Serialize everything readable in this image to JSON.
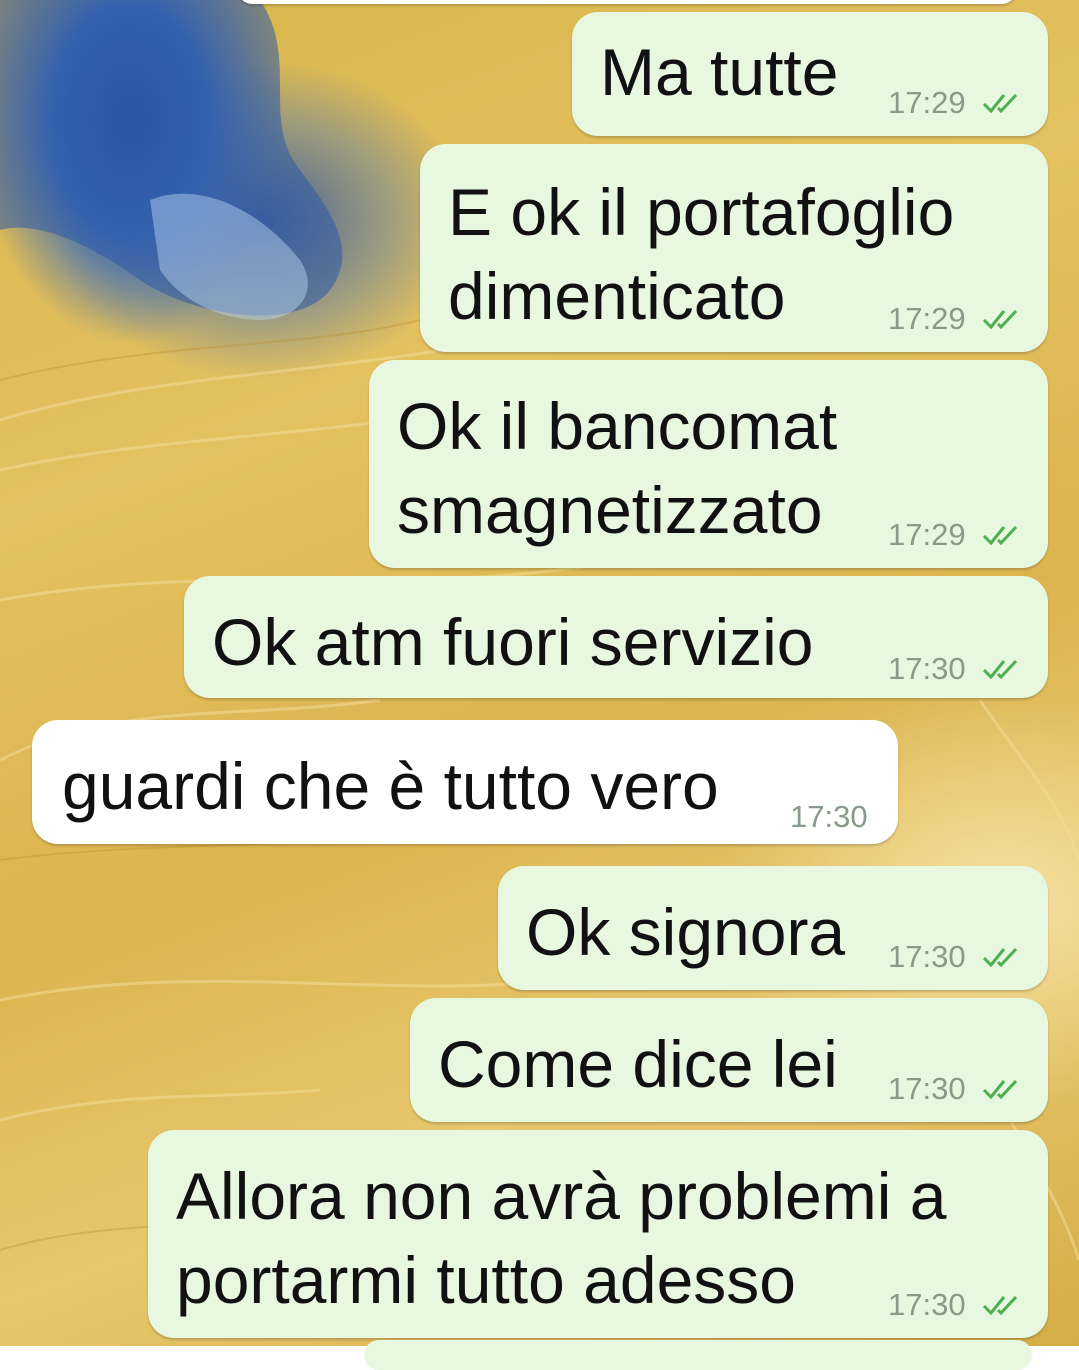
{
  "messages": [
    {
      "direction": "out",
      "text": "Ma tutte",
      "time": "17:29",
      "status_icon": "double-check-icon"
    },
    {
      "direction": "out",
      "text": "E ok il portafoglio\ndimenticato",
      "time": "17:29",
      "status_icon": "double-check-icon"
    },
    {
      "direction": "out",
      "text": "Ok il bancomat\nsmagnetizzato",
      "time": "17:29",
      "status_icon": "double-check-icon"
    },
    {
      "direction": "out",
      "text": "Ok atm fuori servizio",
      "time": "17:30",
      "status_icon": "double-check-icon"
    },
    {
      "direction": "in",
      "text": "guardi che è tutto vero",
      "time": "17:30"
    },
    {
      "direction": "out",
      "text": "Ok signora",
      "time": "17:30",
      "status_icon": "double-check-icon"
    },
    {
      "direction": "out",
      "text": "Come dice lei",
      "time": "17:30",
      "status_icon": "double-check-icon"
    },
    {
      "direction": "out",
      "text": "Allora non avrà problemi a\nportarmi tutto adesso",
      "time": "17:30",
      "status_icon": "double-check-icon"
    }
  ],
  "colors": {
    "outgoing_bubble": "#e8f7e0",
    "incoming_bubble": "#ffffff",
    "read_ticks": "#4caf50",
    "timestamp": "#8a9a8a"
  }
}
